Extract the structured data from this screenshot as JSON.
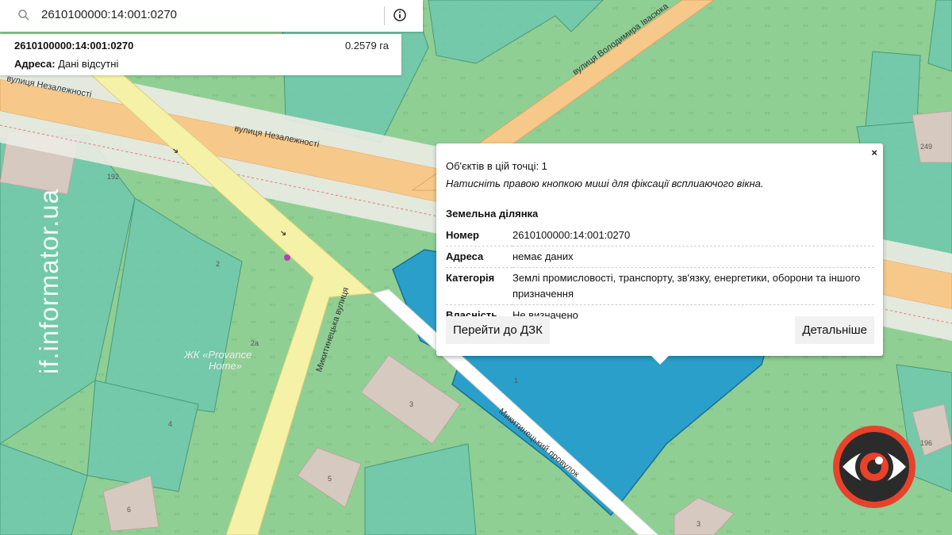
{
  "search": {
    "query": "2610100000:14:001:0270",
    "icon": "search-icon",
    "info_icon": "info-icon"
  },
  "result": {
    "cadastral_number": "2610100000:14:001:0270",
    "area": "0.2579 га",
    "address_label": "Адреса:",
    "address_value": "Дані відсутні"
  },
  "popup": {
    "objects_count": "Об'єктів в цій точці: 1",
    "hint": "Натисніть правою кнопкою миші для фіксації всплиаючого вікна.",
    "close": "×",
    "section_title": "Земельна ділянка",
    "rows": [
      {
        "key": "Номер",
        "value": "2610100000:14:001:0270"
      },
      {
        "key": "Адреса",
        "value": "немає даних"
      },
      {
        "key": "Категорія",
        "value": "Землі промисловості, транспорту, зв'язку, енергетики, оборони та іншого призначення"
      },
      {
        "key": "Власність",
        "value": "Не визначено"
      }
    ],
    "button_dzk": "Перейти до ДЗК",
    "button_details": "Детальніше"
  },
  "map": {
    "streets": {
      "nezalezhnosti_1": "вулиця Незалежності",
      "nezalezhnosti_2": "вулиця Незалежності",
      "ivasyuka": "вулиця Володимира Івасюка",
      "mykytynetska": "Микитинецька вулиця",
      "provulok": "Микитинецький провулок"
    },
    "poi": {
      "provance_1": "ЖК «Provance",
      "provance_2": "Home»"
    },
    "house_numbers": {
      "n192": "192",
      "n2": "2",
      "n2a": "2а",
      "n4": "4",
      "n3": "3",
      "n5": "5",
      "n6": "6",
      "n1": "1",
      "n3b": "3",
      "n196": "196",
      "n249": "249"
    },
    "colors": {
      "land": "#8fcf94",
      "parcel": "#6fc8ae",
      "highlight": "#2a9fc9",
      "main_road": "#f6c98a",
      "secondary_road": "#f5f1a7",
      "building": "#d6c9c0"
    }
  },
  "watermark": {
    "text": "if.informator.ua"
  }
}
